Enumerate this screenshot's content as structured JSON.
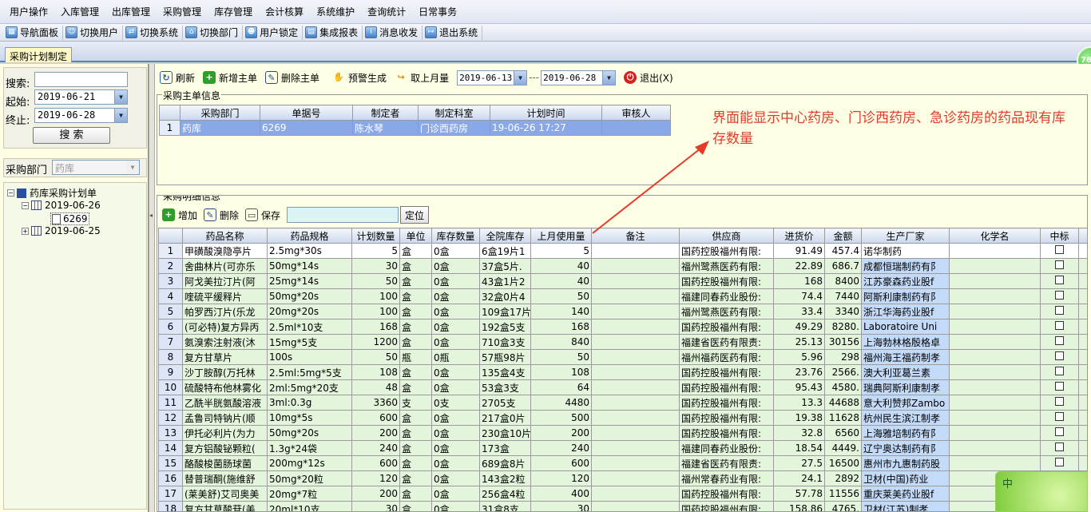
{
  "menu": [
    "用户操作",
    "入库管理",
    "出库管理",
    "采购管理",
    "库存管理",
    "会计核算",
    "系统维护",
    "查询统计",
    "日常事务"
  ],
  "toolbar": [
    {
      "label": "导航面板",
      "icon": "navigation-icon"
    },
    {
      "label": "切换用户",
      "icon": "switch-user-icon"
    },
    {
      "label": "切换系统",
      "icon": "switch-system-icon"
    },
    {
      "label": "切换部门",
      "icon": "switch-department-icon"
    },
    {
      "label": "用户锁定",
      "icon": "user-lock-icon"
    },
    {
      "label": "集成报表",
      "icon": "report-icon"
    },
    {
      "label": "消息收发",
      "icon": "message-icon"
    },
    {
      "label": "退出系统",
      "icon": "exit-icon"
    }
  ],
  "tab_title": "采购计划制定",
  "badge": "76",
  "search": {
    "search_label": "搜索:",
    "search_value": "",
    "start_label": "起始:",
    "start_value": "2019-06-21",
    "end_label": "终止:",
    "end_value": "2019-06-28",
    "button": "搜  索"
  },
  "department": {
    "label": "采购部门",
    "value": "药库"
  },
  "tree": {
    "root": "药库采购计划单",
    "node1": "2019-06-26",
    "leaf1": "6269",
    "node2": "2019-06-25"
  },
  "actions": {
    "refresh": "刷新",
    "new_master": "新增主单",
    "delete_master": "删除主单",
    "alert": "预警生成",
    "last_month": "取上月量",
    "date_from": "2019-06-13",
    "sep": "---",
    "date_to": "2019-06-28",
    "exit": "退出(X)"
  },
  "master": {
    "title": "采购主单信息",
    "columns": [
      "采购部门",
      "单据号",
      "制定者",
      "制定科室",
      "计划时间",
      "审核人"
    ],
    "rows": [
      [
        "1",
        "药库",
        "6269",
        "陈水琴",
        "门诊西药房",
        "19-06-26 17:27",
        ""
      ]
    ]
  },
  "annotation": "界面能显示中心药房、门诊西药房、急诊药房的药品现有库存数量",
  "detail": {
    "title": "采购明细信息",
    "add": "增加",
    "delete": "删除",
    "save": "保存",
    "locate_value": "",
    "locate": "定位",
    "columns": [
      "药品名称",
      "药品规格",
      "计划数量",
      "单位",
      "库存数量",
      "全院库存",
      "上月使用量",
      "备注",
      "供应商",
      "进货价",
      "金额",
      "生产厂家",
      "化学名",
      "中标"
    ],
    "rows": [
      [
        "1",
        "甲磺酸溴隐亭片",
        "2.5mg*30s",
        "5",
        "盒",
        "0盒",
        "6盒19片1",
        "5",
        "",
        "国药控股福州有限:",
        "91.49",
        "457.4",
        "诺华制药",
        "",
        ""
      ],
      [
        "2",
        "舍曲林片(可亦乐",
        "50mg*14s",
        "30",
        "盒",
        "0盒",
        "37盒5片.",
        "40",
        "",
        "福州鹭燕医药有限:",
        "22.89",
        "686.7",
        "成都恒瑞制药有阝",
        "",
        ""
      ],
      [
        "3",
        "阿戈美拉汀片(阿",
        "25mg*14s",
        "50",
        "盒",
        "0盒",
        "43盒1片2",
        "40",
        "",
        "国药控股福州有限:",
        "168",
        "8400",
        "江苏豪森药业股f",
        "",
        ""
      ],
      [
        "4",
        "喹硫平缓释片",
        "50mg*20s",
        "100",
        "盒",
        "0盒",
        "32盒0片4",
        "50",
        "",
        "福建同春药业股份:",
        "74.4",
        "7440",
        "阿斯利康制药有阝",
        "",
        ""
      ],
      [
        "5",
        "帕罗西汀片(乐龙",
        "20mg*20s",
        "100",
        "盒",
        "0盒",
        "109盒17片",
        "140",
        "",
        "福州鹭燕医药有限:",
        "33.4",
        "3340",
        "浙江华海药业股f",
        "",
        ""
      ],
      [
        "6",
        "(可必特)复方异丙",
        "2.5ml*10支",
        "168",
        "盒",
        "0盒",
        "192盒5支",
        "168",
        "",
        "国药控股福州有限:",
        "49.29",
        "8280.",
        "Laboratoire Uni",
        "",
        ""
      ],
      [
        "7",
        "氨溴索注射液(沐",
        "15mg*5支",
        "1200",
        "盒",
        "0盒",
        "710盒3支",
        "840",
        "",
        "福建省医药有限责:",
        "25.13",
        "30156",
        "上海勃林格殷格卓",
        "",
        ""
      ],
      [
        "8",
        "复方甘草片",
        "100s",
        "50",
        "瓶",
        "0瓶",
        "57瓶98片",
        "50",
        "",
        "福州福药医药有限:",
        "5.96",
        "298",
        "福州海王福药制孝",
        "",
        ""
      ],
      [
        "9",
        "沙丁胺醇(万托林",
        "2.5ml:5mg*5支",
        "108",
        "盒",
        "0盒",
        "135盒4支",
        "108",
        "",
        "国药控股福州有限:",
        "23.76",
        "2566.",
        "澳大利亚葛兰素",
        "",
        ""
      ],
      [
        "10",
        "硫酸特布他林雾化",
        "2ml:5mg*20支",
        "48",
        "盒",
        "0盒",
        "53盒3支",
        "64",
        "",
        "国药控股福州有限:",
        "95.43",
        "4580.",
        "瑞典阿斯利康制孝",
        "",
        ""
      ],
      [
        "11",
        "乙酰半胱氨酸溶液",
        "3ml:0.3g",
        "3360",
        "支",
        "0支",
        "2705支",
        "4480",
        "",
        "国药控股福州有限:",
        "13.3",
        "44688",
        "意大利赞邦Zambo",
        "",
        ""
      ],
      [
        "12",
        "孟鲁司特钠片(顺",
        "10mg*5s",
        "600",
        "盒",
        "0盒",
        "217盒0片",
        "500",
        "",
        "国药控股福州有限:",
        "19.38",
        "11628",
        "杭州民生滨江制孝",
        "",
        ""
      ],
      [
        "13",
        "伊托必利片(为力",
        "50mg*20s",
        "200",
        "盒",
        "0盒",
        "230盒10片",
        "200",
        "",
        "国药控股福州有限:",
        "32.8",
        "6560",
        "上海雅培制药有阝",
        "",
        ""
      ],
      [
        "14",
        "复方铝酸铋颗粒(",
        "1.3g*24袋",
        "240",
        "盒",
        "0盒",
        "173盒",
        "240",
        "",
        "福建同春药业股份:",
        "18.54",
        "4449.",
        "辽宁奥达制药有阝",
        "",
        ""
      ],
      [
        "15",
        "酪酸梭菌肠球菌",
        "200mg*12s",
        "600",
        "盒",
        "0盒",
        "689盒8片",
        "600",
        "",
        "福建省医药有限责:",
        "27.5",
        "16500",
        "惠州市九惠制药股",
        "",
        ""
      ],
      [
        "16",
        "替普瑞酮(施维舒",
        "50mg*20粒",
        "120",
        "盒",
        "0盒",
        "143盒2粒",
        "120",
        "",
        "福州常春药业有限:",
        "24.1",
        "2892",
        "卫材(中国)药业",
        "",
        ""
      ],
      [
        "17",
        "(莱美舒)艾司奥美",
        "20mg*7粒",
        "200",
        "盒",
        "0盒",
        "256盒4粒",
        "400",
        "",
        "国药控股福州有限:",
        "57.78",
        "11556",
        "重庆莱美药业股f",
        "",
        ""
      ],
      [
        "18",
        "复方甘草酸苷(美",
        "20ml*10支",
        "30",
        "盒",
        "0盒",
        "31盒8支",
        "30",
        "",
        "国药控股福州有限:",
        "158.86",
        "4765.",
        "卫材(江苏)制孝",
        "",
        ""
      ]
    ]
  },
  "corner_text": "中"
}
